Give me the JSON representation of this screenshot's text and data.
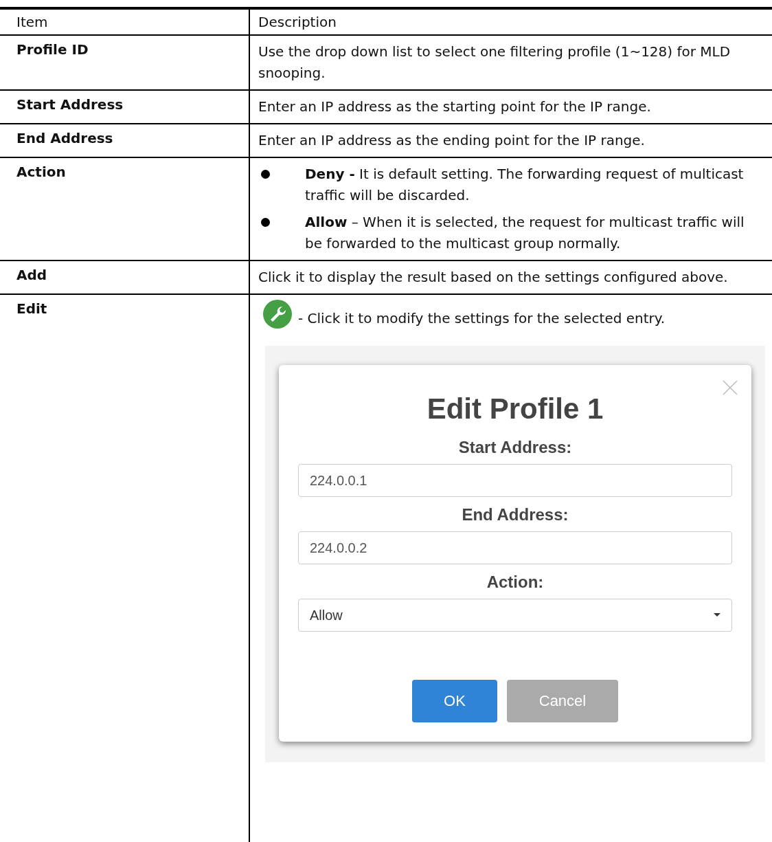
{
  "table": {
    "columns": [
      "Item",
      "Description"
    ],
    "rows": [
      {
        "item": "Profile ID",
        "description": [
          {
            "kind": "text",
            "text": "Use the drop down list to select one filtering profile (1~128) for MLD snooping."
          }
        ]
      },
      {
        "item": "Start Address",
        "description": [
          {
            "kind": "text",
            "text": "Enter an IP address as the starting point for the IP range."
          }
        ]
      },
      {
        "item": "End Address",
        "description": [
          {
            "kind": "text",
            "text": "Enter an IP address as the ending point for the IP range."
          }
        ]
      },
      {
        "item": "Action",
        "description": [
          {
            "kind": "bullets",
            "items": [
              "**Deny -** It is default setting. The forwarding request of multicast traffic will be discarded.",
              "**Allow** – When it is selected, the request for multicast traffic will be forwarded to the multicast group normally."
            ]
          }
        ]
      },
      {
        "item": "Add",
        "description": [
          {
            "kind": "text",
            "text": "Click it to display the result based on the settings configured above."
          }
        ]
      },
      {
        "item": "Edit",
        "description": [
          {
            "kind": "icon_text",
            "text": "- Click it to modify the settings for the selected entry."
          },
          {
            "kind": "dialog",
            "title": "Edit Profile 1",
            "fields": [
              {
                "label": "Start Address:",
                "kind": "input",
                "value": "224.0.0.1"
              },
              {
                "label": "End Address:",
                "kind": "input",
                "value": "224.0.0.2"
              },
              {
                "label": "Action:",
                "kind": "select",
                "value": "Allow"
              }
            ],
            "buttons": [
              {
                "label": "OK",
                "kind": "primary"
              },
              {
                "label": "Cancel",
                "kind": "secondary"
              }
            ]
          }
        ]
      }
    ]
  }
}
